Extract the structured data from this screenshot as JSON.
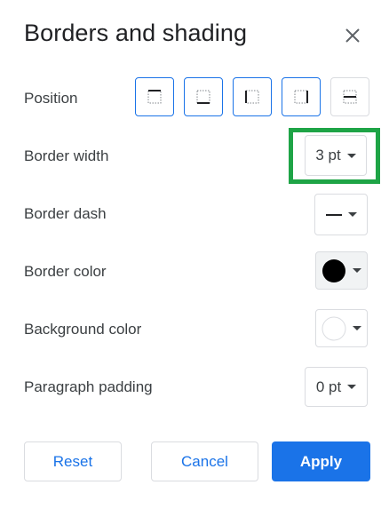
{
  "dialog": {
    "title": "Borders and shading",
    "close_icon": "close-icon"
  },
  "rows": {
    "position_label": "Position",
    "border_width_label": "Border width",
    "border_width_value": "3 pt",
    "border_dash_label": "Border dash",
    "border_color_label": "Border color",
    "border_color_value": "#000000",
    "background_color_label": "Background color",
    "background_color_value": "#ffffff",
    "paragraph_padding_label": "Paragraph padding",
    "paragraph_padding_value": "0 pt"
  },
  "position_buttons": [
    {
      "icon": "border-top-icon",
      "selected": true
    },
    {
      "icon": "border-bottom-icon",
      "selected": true
    },
    {
      "icon": "border-left-icon",
      "selected": true
    },
    {
      "icon": "border-right-icon",
      "selected": true
    },
    {
      "icon": "border-between-icon",
      "selected": false
    }
  ],
  "footer": {
    "reset_label": "Reset",
    "cancel_label": "Cancel",
    "apply_label": "Apply"
  },
  "colors": {
    "accent": "#1a73e8",
    "highlight": "#1ea446"
  }
}
